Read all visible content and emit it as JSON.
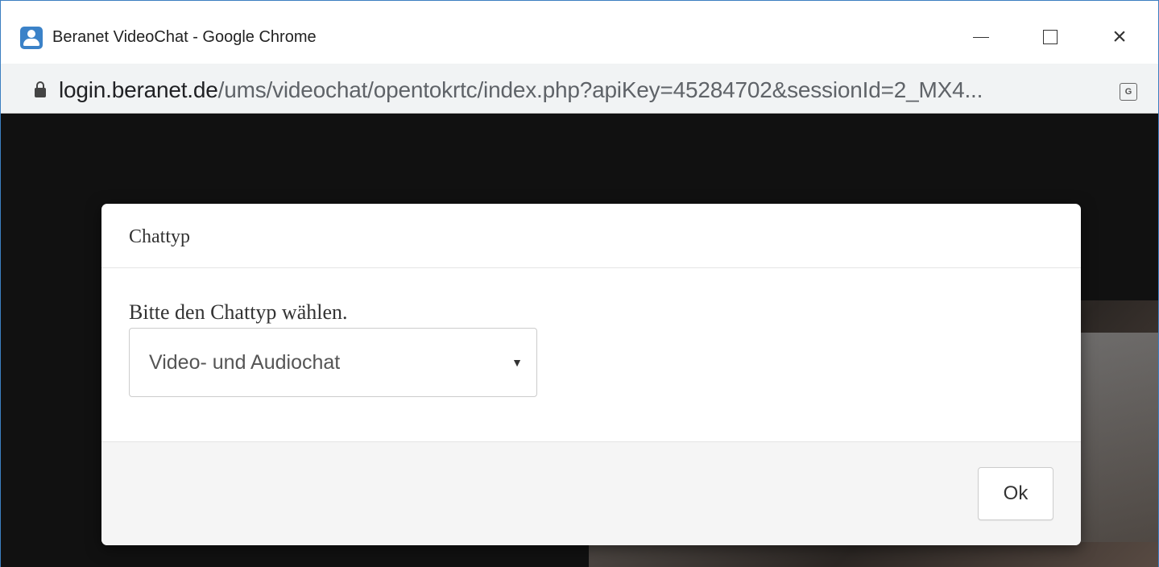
{
  "window": {
    "title": "Beranet VideoChat - Google Chrome",
    "accent_color": "#3c7fc1",
    "app_icon": "beranet-person-icon"
  },
  "addressbar": {
    "url_host": "login.beranet.de",
    "url_path": "/ums/videochat/opentokrtc/index.php?apiKey=45284702&sessionId=2_MX4...",
    "secure_icon": "lock-icon",
    "translate_icon": "google-translate-icon",
    "translate_glyph": "G"
  },
  "modal": {
    "title": "Chattyp",
    "prompt": "Bitte den Chattyp wählen.",
    "select": {
      "selected": "Video- und Audiochat"
    },
    "ok_label": "Ok"
  }
}
